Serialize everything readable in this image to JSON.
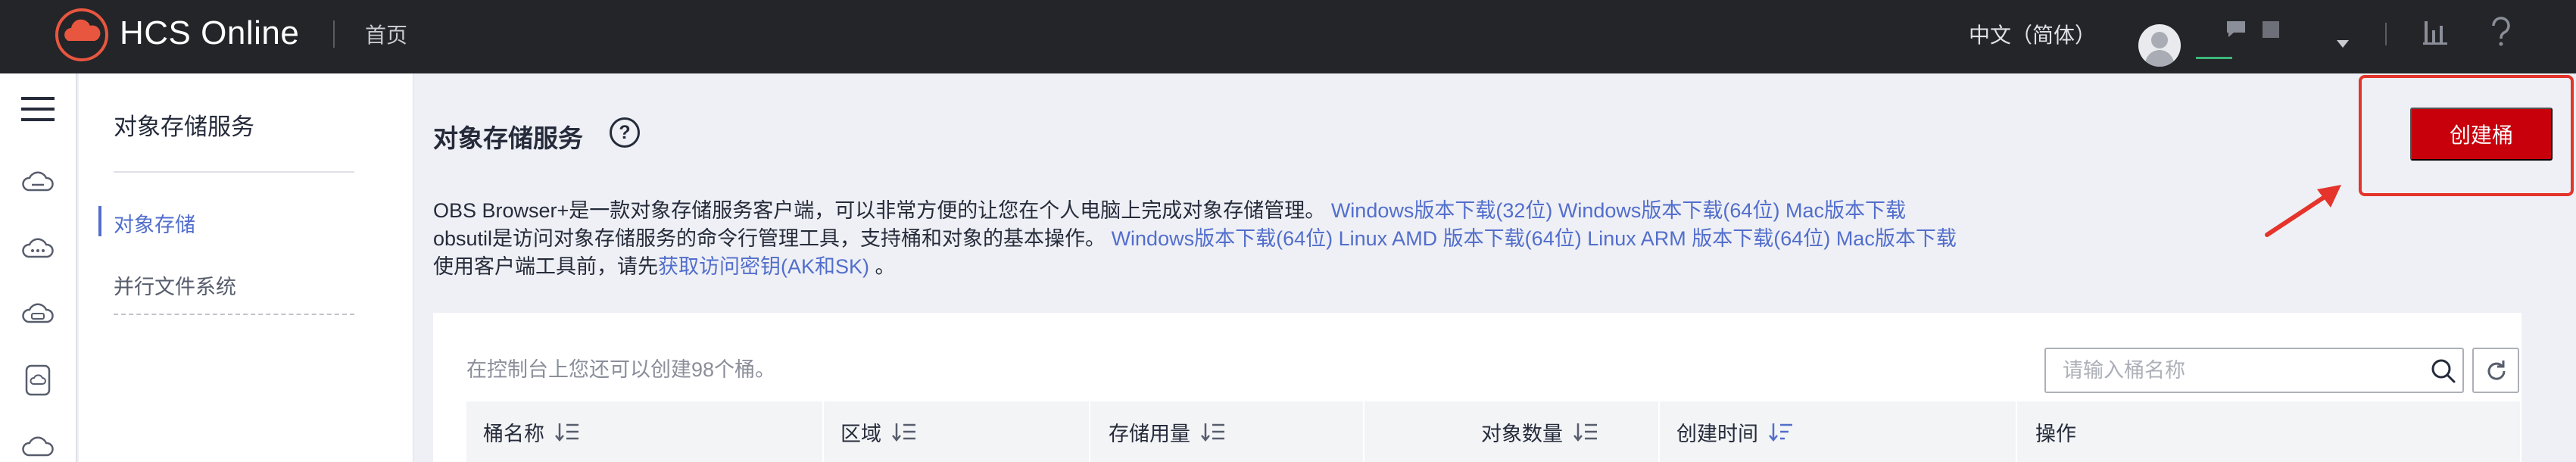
{
  "topbar": {
    "brand": "HCS Online",
    "home": "首页",
    "language": "中文（简体）"
  },
  "subnav": {
    "title": "对象存储服务",
    "items": [
      {
        "label": "对象存储",
        "active": true
      },
      {
        "label": "并行文件系统",
        "active": false
      }
    ]
  },
  "main": {
    "title": "对象存储服务",
    "create_button": "创建桶",
    "info": {
      "line1_text": "OBS Browser+是一款对象存储服务客户端，可以非常方便的让您在个人电脑上完成对象存储管理。",
      "line1_links": [
        "Windows版本下载(32位)",
        "Windows版本下载(64位)",
        "Mac版本下载"
      ],
      "line2_text": "obsutil是访问对象存储服务的命令行管理工具，支持桶和对象的基本操作。",
      "line2_links": [
        "Windows版本下载(64位)",
        "Linux AMD 版本下载(64位)",
        "Linux ARM 版本下载(64位)",
        "Mac版本下载"
      ],
      "line3_text": "使用客户端工具前，请先",
      "line3_link": "获取访问密钥(AK和SK)",
      "line3_tail": " 。"
    },
    "quota_text": "在控制台上您还可以创建98个桶。",
    "search": {
      "placeholder": "请输入桶名称",
      "value": ""
    },
    "table": {
      "columns": [
        "桶名称",
        "区域",
        "存储用量",
        "对象数量",
        "创建时间",
        "操作"
      ]
    }
  },
  "colors": {
    "topbar": "#242528",
    "accent": "#526ecc",
    "create_button": "#c7000b",
    "annotation": "#e4342b"
  }
}
